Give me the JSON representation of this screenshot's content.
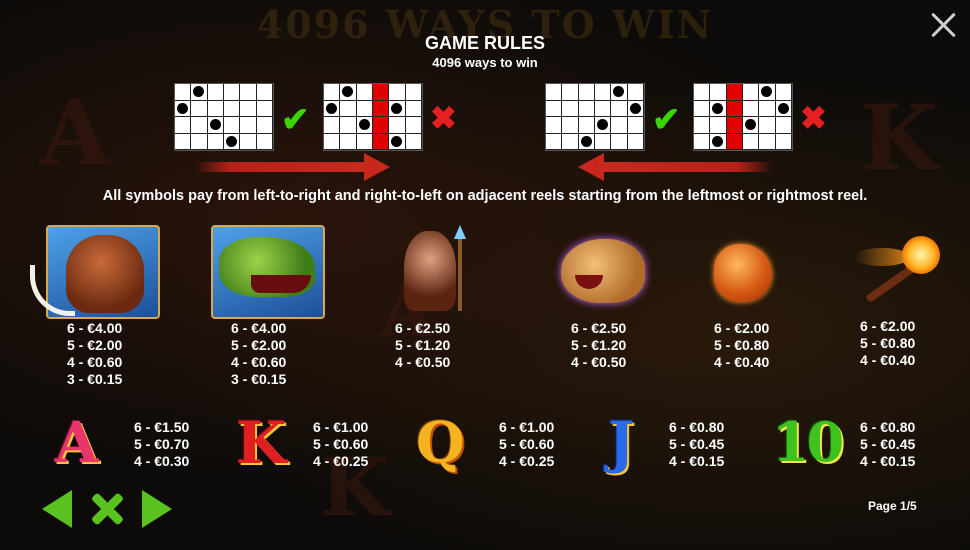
{
  "background": {
    "title": "4096 WAYS TO WIN"
  },
  "header": {
    "title": "GAME RULES",
    "subtitle": "4096 ways to win"
  },
  "rule_text": "All symbols pay from left-to-right and right-to-left on adjacent reels starting from the leftmost or rightmost reel.",
  "colors": {
    "accent_green": "#59c21e",
    "check_green": "#3bd400",
    "cross_red": "#e52020",
    "arrow_red": "#c8281c"
  },
  "high_symbols": [
    {
      "name": "mammoth",
      "pays": [
        "6 - €4.00",
        "5 - €2.00",
        "4 - €0.60",
        "3 - €0.15"
      ]
    },
    {
      "name": "t-rex",
      "pays": [
        "6 - €4.00",
        "5 - €2.00",
        "4 - €0.60",
        "3 - €0.15"
      ]
    },
    {
      "name": "cavewoman",
      "pays": [
        "6 - €2.50",
        "5 - €1.20",
        "4 - €0.50"
      ]
    },
    {
      "name": "sabertooth",
      "pays": [
        "6 - €2.50",
        "5 - €1.20",
        "4 - €0.50"
      ]
    },
    {
      "name": "amber",
      "pays": [
        "6 - €2.00",
        "5 - €0.80",
        "4 - €0.40"
      ]
    },
    {
      "name": "torch",
      "pays": [
        "6 - €2.00",
        "5 - €0.80",
        "4 - €0.40"
      ]
    }
  ],
  "low_symbols": [
    {
      "glyph": "A",
      "pays": [
        "6 - €1.50",
        "5 - €0.70",
        "4 - €0.30"
      ]
    },
    {
      "glyph": "K",
      "pays": [
        "6 - €1.00",
        "5 - €0.60",
        "4 - €0.25"
      ]
    },
    {
      "glyph": "Q",
      "pays": [
        "6 - €1.00",
        "5 - €0.60",
        "4 - €0.25"
      ]
    },
    {
      "glyph": "J",
      "pays": [
        "6 - €0.80",
        "5 - €0.45",
        "4 - €0.15"
      ]
    },
    {
      "glyph": "10",
      "pays": [
        "6 - €0.80",
        "5 - €0.45",
        "4 - €0.15"
      ]
    }
  ],
  "icons": {
    "check": "✔",
    "cross": "✖"
  },
  "footer": {
    "page": "Page 1/5"
  }
}
